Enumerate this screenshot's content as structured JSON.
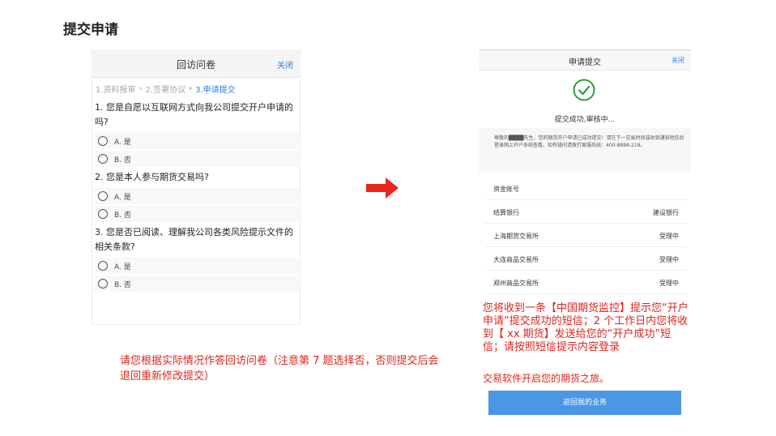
{
  "page_title": "提交申请",
  "left_phone": {
    "title": "回访问卷",
    "close_label": "关闭",
    "steps": [
      "1.资料报审",
      "›",
      "2.签署协议",
      "›",
      "3.申请提交"
    ],
    "questions": [
      {
        "text": "1. 您是自愿以互联网方式向我公司提交开户申请的吗?",
        "options": [
          "A. 是",
          "B. 否"
        ]
      },
      {
        "text": "2. 您是本人参与期货交易吗?",
        "options": [
          "A. 是",
          "B. 否"
        ]
      },
      {
        "text": "3. 您是否已阅读、理解我公司各类风险提示文件的相关条款?",
        "options": [
          "A. 是",
          "B. 否"
        ]
      }
    ]
  },
  "left_note": "请您根据实际情况作答回访问卷（注意第 7 题选择否，否则提交后会退回重新修改提交）",
  "right_phone": {
    "title": "申请提交",
    "close_label": "关闭",
    "success_text": "提交成功,审核中...",
    "message": "尊敬的████先生，您的期货开户申请已成功提交！请在下一交易时间或收到通知短信后登录网上开户系统查看。如有疑问请拨打客服热线：400-8888-218。",
    "rows": [
      {
        "label": "资金账号",
        "value": ""
      },
      {
        "label": "结算银行",
        "value": "建设银行"
      },
      {
        "label": "上海期货交易所",
        "value": "受理中"
      },
      {
        "label": "大连商品交易所",
        "value": "受理中"
      },
      {
        "label": "郑州商品交易所",
        "value": "受理中"
      }
    ]
  },
  "right_note": "您将收到一条【中国期货监控】提示您“开户申请”提交成功的短信；2 个工作日内您将收到【 xx 期货】发送给您的“开户成功”短信；请按照短信提示内容登录",
  "right_note_2": "交易软件开启您的期货之旅。",
  "return_button": "返回我的业务",
  "colors": {
    "accent": "#2d7fe0",
    "note_red": "#e0251c",
    "success_green": "#2e9e3e",
    "button_blue": "#4a97e6"
  }
}
